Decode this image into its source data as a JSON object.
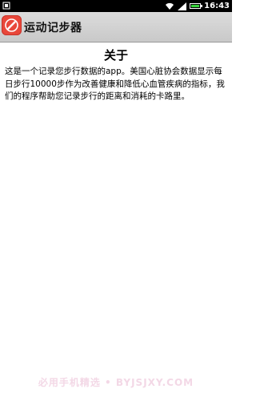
{
  "status_bar": {
    "time": "16:43"
  },
  "app": {
    "title": "运动记步器",
    "icon": "pencil-icon"
  },
  "content": {
    "heading": "关于",
    "body": "这是一个记录您步行数据的app。美国心脏协会数据显示每日步行10000步作为改善健康和降低心血管疾病的指标，我们的程序帮助您记录步行的距离和消耗的卡路里。"
  },
  "watermark": "必用手机精选 • BYJSJXY.COM",
  "colors": {
    "action_bar": "#d3d3d3",
    "app_icon": "#e8473a",
    "status_bar": "#000000"
  }
}
